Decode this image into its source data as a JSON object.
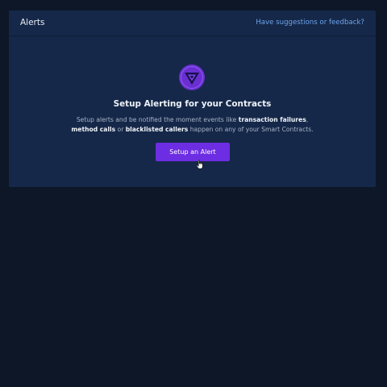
{
  "header": {
    "title": "Alerts",
    "feedback_link": "Have suggestions or feedback?"
  },
  "empty_state": {
    "logo_icon": "alerting-logo-icon",
    "title": "Setup Alerting for your Contracts",
    "description": {
      "part1": "Setup alerts and be notified the moment events like ",
      "bold1": "transaction failures",
      "part2": ",",
      "bold2": "method calls",
      "part3": " or ",
      "bold3": "blacklisted callers",
      "part4": " happen on any of your Smart Contracts."
    },
    "button_label": "Setup an Alert"
  },
  "colors": {
    "background": "#0d1728",
    "panel": "#152849",
    "accent": "#6d2de3",
    "link": "#6ea3ea"
  }
}
